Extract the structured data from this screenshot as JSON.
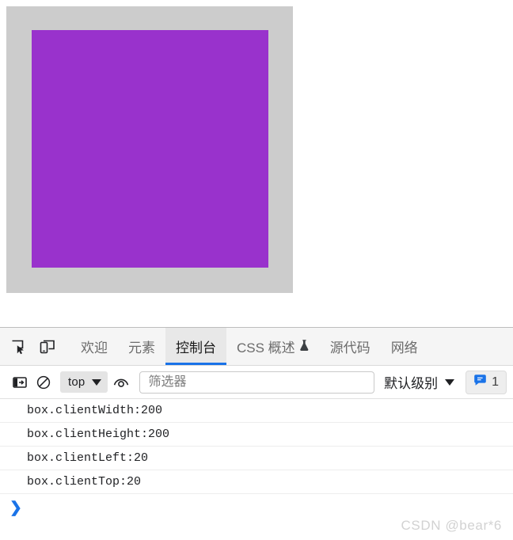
{
  "page": {
    "container": {
      "name": "outer-container",
      "background": "#cccccc"
    },
    "box": {
      "name": "box",
      "background": "#9932cc"
    }
  },
  "devtools": {
    "toolbar_icons": [
      {
        "name": "inspect-element-icon",
        "title": "检查"
      },
      {
        "name": "device-toolbar-icon",
        "title": "设备工具栏"
      }
    ],
    "tabs": [
      {
        "id": "welcome",
        "label": "欢迎",
        "active": false,
        "experimental": false
      },
      {
        "id": "elements",
        "label": "元素",
        "active": false,
        "experimental": false
      },
      {
        "id": "console",
        "label": "控制台",
        "active": true,
        "experimental": false
      },
      {
        "id": "css-overview",
        "label": "CSS 概述",
        "active": false,
        "experimental": true
      },
      {
        "id": "sources",
        "label": "源代码",
        "active": false,
        "experimental": false
      },
      {
        "id": "network",
        "label": "网络",
        "active": false,
        "experimental": false
      }
    ],
    "active_tab_underline_color": "#1a73e8",
    "console_toolbar": {
      "sidebar_toggle_icon": "console-sidebar-toggle-icon",
      "clear_console_icon": "clear-console-icon",
      "context_selector": {
        "label": "top",
        "caret": "▼"
      },
      "live_expression_icon": "eye-icon",
      "filter": {
        "value": "",
        "placeholder": "筛选器"
      },
      "level_selector": {
        "label": "默认级别",
        "caret": "▼"
      },
      "message_badge": {
        "icon": "message-bubble-icon",
        "count": "1",
        "color": "#1a73e8"
      }
    },
    "console_messages": [
      "box.clientWidth:200",
      "box.clientHeight:200",
      "box.clientLeft:20",
      "box.clientTop:20"
    ],
    "prompt": {
      "chevron": "❯",
      "value": "",
      "placeholder": ""
    }
  },
  "watermark": "CSDN @bear*6"
}
